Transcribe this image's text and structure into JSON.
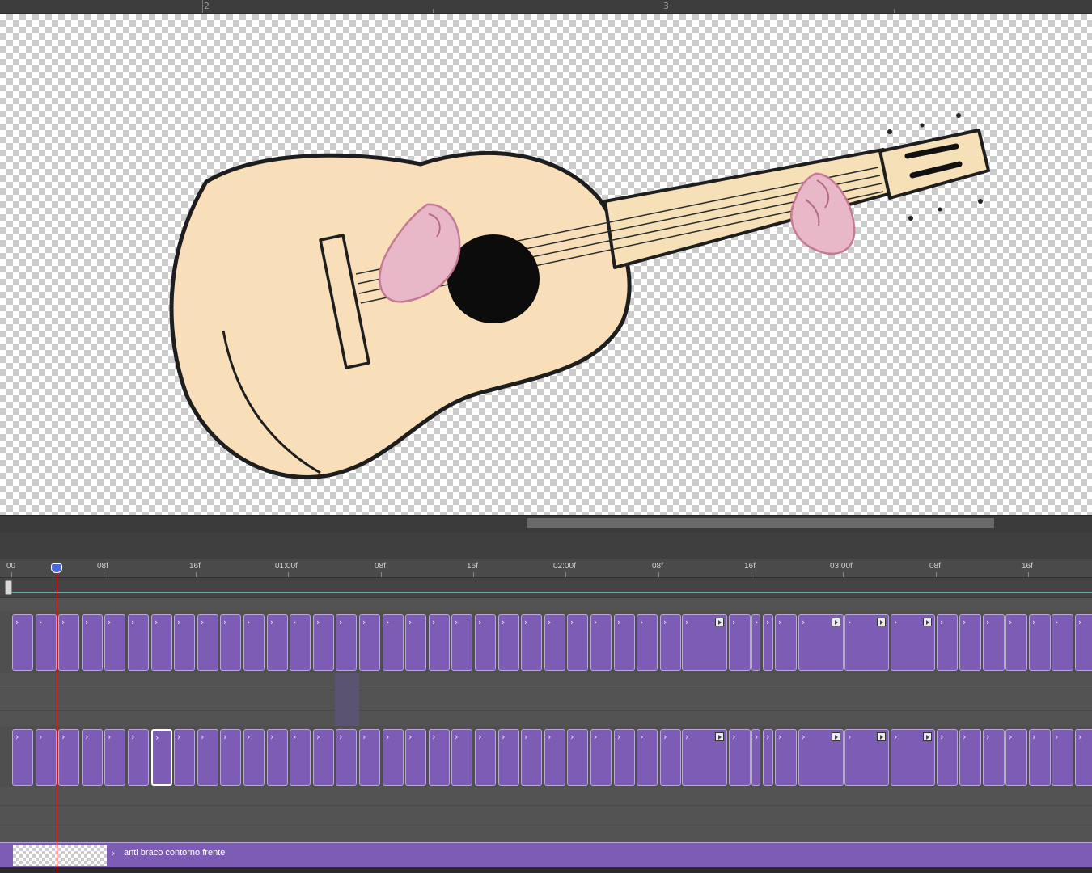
{
  "ruler": {
    "marks": [
      "2",
      "3"
    ]
  },
  "timeline": {
    "time_labels": [
      "00",
      "08f",
      "16f",
      "01:00f",
      "08f",
      "16f",
      "02:00f",
      "08f",
      "16f",
      "03:00f",
      "08f",
      "16f"
    ]
  },
  "layers": {
    "bottom_layer_name": "anti braco contorno frente"
  },
  "colors": {
    "clip_fill": "#7c5cb5",
    "clip_border": "#b8a6dc",
    "playhead": "#e02424",
    "playhead_handle": "#4a6ad8",
    "work_area_line": "#6fa7a7"
  },
  "icons": {
    "clip_start": "chevron-right-icon",
    "clip_marker": "play-marker-icon",
    "playhead": "playhead-icon"
  }
}
